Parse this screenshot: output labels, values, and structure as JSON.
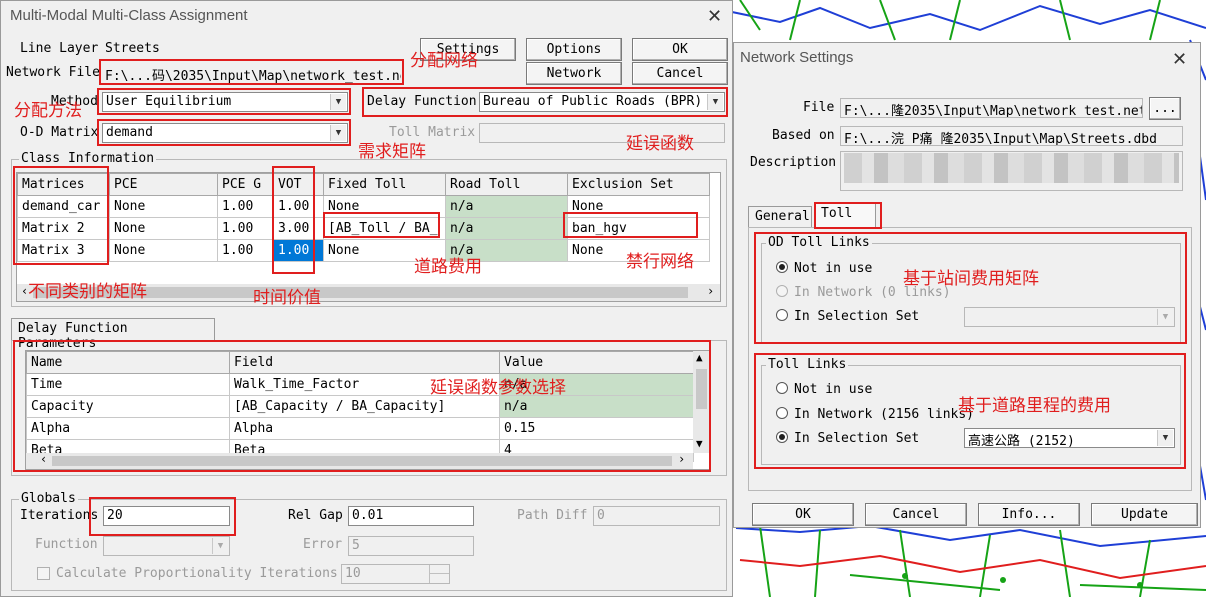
{
  "main_dialog": {
    "title": "Multi-Modal Multi-Class Assignment",
    "line_layer_label": "Line Layer",
    "line_layer_value": "Streets",
    "network_file_label": "Network File",
    "network_file_value": "F:\\...码\\2035\\Input\\Map\\network_test.ne",
    "method_label": "Method",
    "method_value": "User Equilibrium",
    "od_matrix_label": "O-D Matrix",
    "od_matrix_value": "demand",
    "delay_function_label": "Delay Function",
    "delay_function_value": "Bureau of Public Roads (BPR)",
    "toll_matrix_label": "Toll Matrix",
    "buttons": {
      "settings": "Settings",
      "options": "Options",
      "ok": "OK",
      "network": "Network",
      "cancel": "Cancel"
    },
    "class_info": {
      "title": "Class Information",
      "headers": [
        "Matrices",
        "PCE",
        "PCE G",
        "VOT",
        "Fixed Toll",
        "Road Toll",
        "Exclusion Set"
      ],
      "rows": [
        [
          "demand_car",
          "None",
          "1.00",
          "1.00",
          "None",
          "n/a",
          "None"
        ],
        [
          "Matrix 2",
          "None",
          "1.00",
          "3.00",
          "[AB_Toll / BA_",
          "n/a",
          "ban_hgv"
        ],
        [
          "Matrix 3",
          "None",
          "1.00",
          "1.00",
          "None",
          "n/a",
          "None"
        ]
      ]
    },
    "delay_params": {
      "tab": "Delay Function Parameters",
      "headers": [
        "Name",
        "Field",
        "Value"
      ],
      "rows": [
        [
          "Time",
          "Walk_Time_Factor",
          "n/a"
        ],
        [
          "Capacity",
          "[AB_Capacity / BA_Capacity]",
          "n/a"
        ],
        [
          "Alpha",
          "Alpha",
          "0.15"
        ],
        [
          "Beta",
          "Beta",
          "4"
        ]
      ]
    },
    "globals": {
      "title": "Globals",
      "iterations_label": "Iterations",
      "iterations_value": "20",
      "rel_gap_label": "Rel Gap",
      "rel_gap_value": "0.01",
      "path_diff_label": "Path Diff",
      "path_diff_value": "0",
      "function_label": "Function",
      "error_label": "Error",
      "error_value": "5",
      "calc_prop_label": "Calculate Proportionality Iterations",
      "calc_prop_value": "10"
    }
  },
  "network_dialog": {
    "title": "Network Settings",
    "file_label": "File",
    "file_value": "F:\\...隆2035\\Input\\Map\\network_test.net",
    "based_on_label": "Based on",
    "based_on_value": "F:\\...浣 P痛 隆2035\\Input\\Map\\Streets.dbd",
    "description_label": "Description",
    "browse_button": "...",
    "tabs": [
      "General",
      "Toll"
    ],
    "od_toll": {
      "title": "OD Toll Links",
      "options": [
        "Not in use",
        "In Network (0 links)",
        "In Selection Set"
      ]
    },
    "toll_links": {
      "title": "Toll Links",
      "options": [
        "Not in use",
        "In Network (2156 links)",
        "In Selection Set"
      ],
      "selection_value": "高速公路 (2152)"
    },
    "buttons": [
      "OK",
      "Cancel",
      "Info...",
      "Update"
    ]
  },
  "annotations": {
    "assign_network": "分配网络",
    "assign_method": "分配方法",
    "demand_matrix": "需求矩阵",
    "delay_function": "延误函数",
    "matrix_classes": "不同类别的矩阵",
    "vot": "时间价值",
    "road_toll": "道路费用",
    "ban_network": "禁行网络",
    "delay_params": "延误函数参数选择",
    "station_toll": "基于站间费用矩阵",
    "mileage_toll": "基于道路里程的费用"
  },
  "colors": {
    "annotation": "#e01e1e",
    "selected_cell": "#0078d7",
    "green_cell": "#c8dfc8"
  }
}
